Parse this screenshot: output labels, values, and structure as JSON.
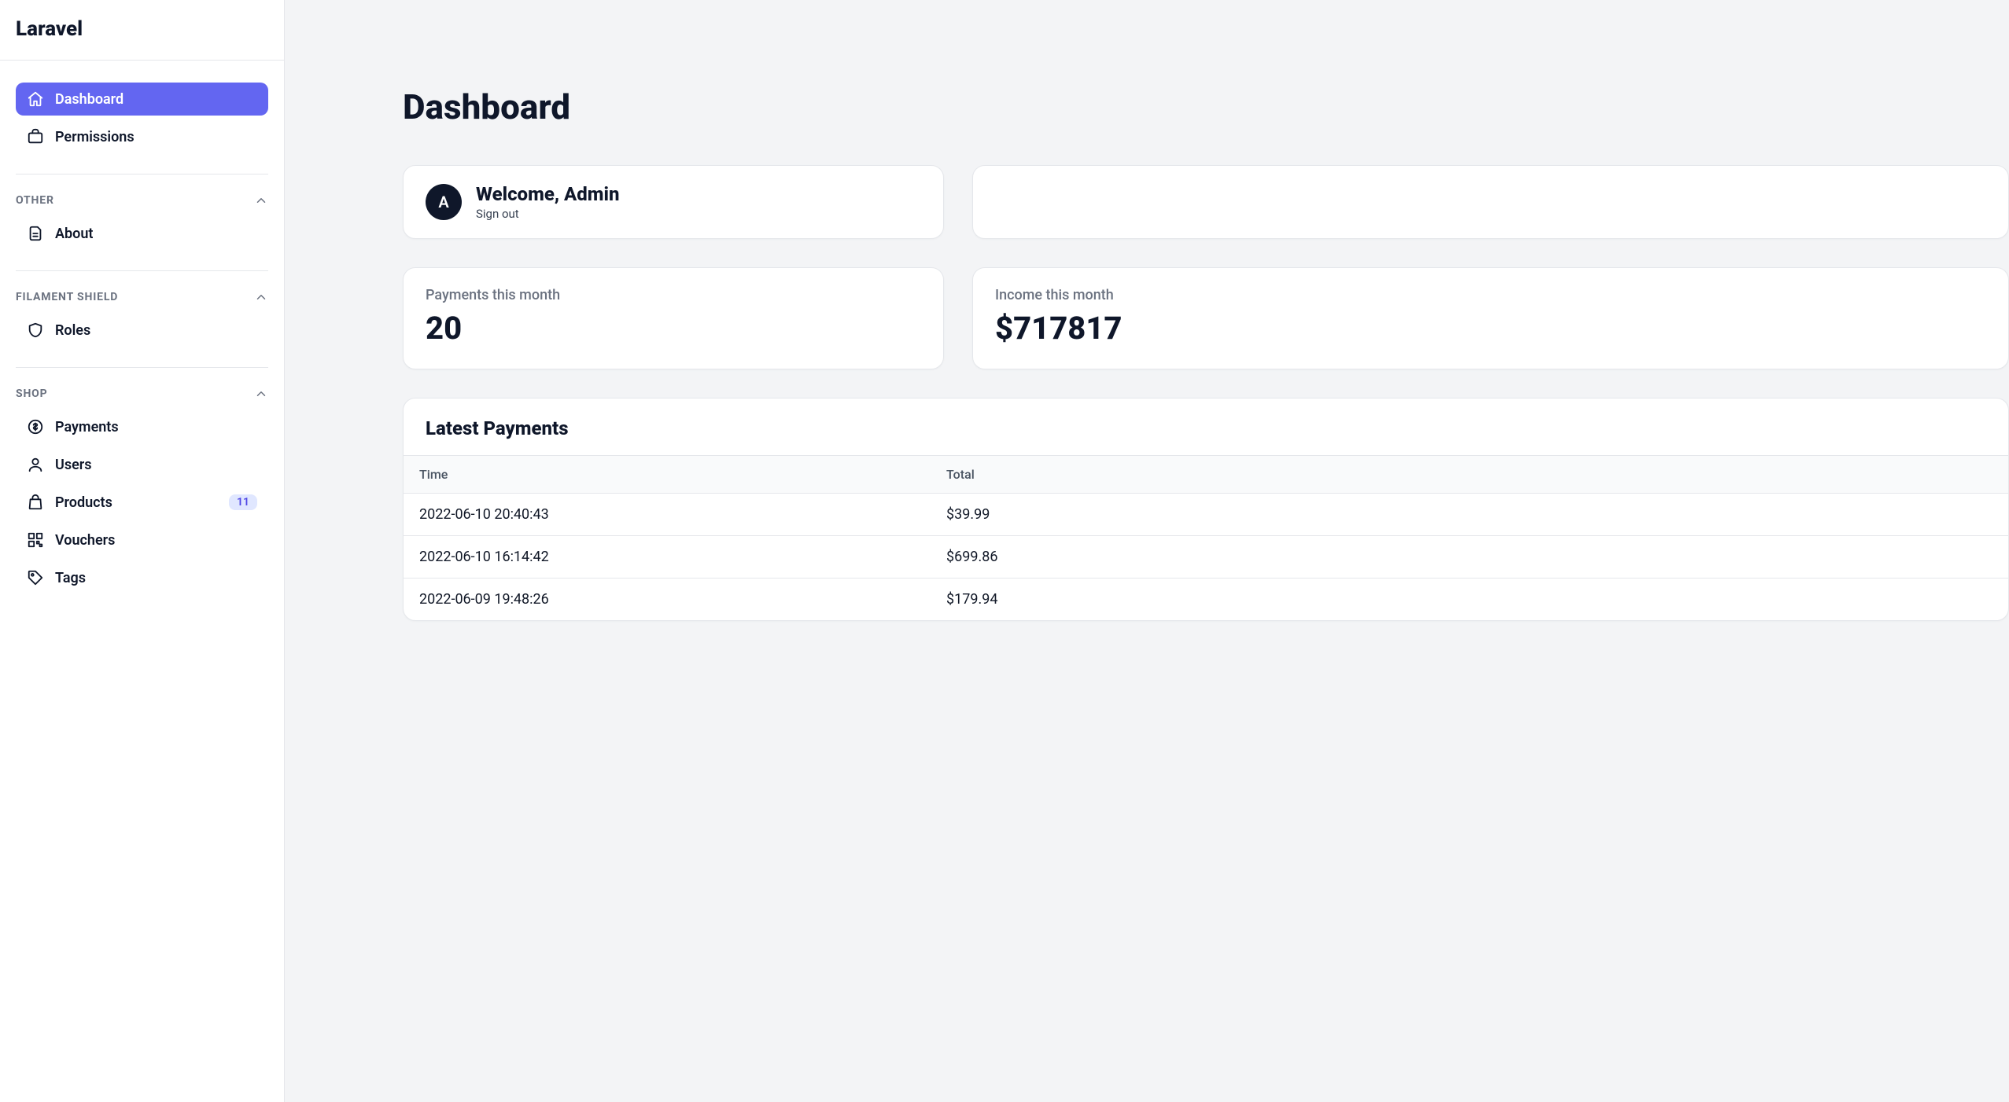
{
  "brand": "Laravel",
  "sidebar": {
    "top": [
      {
        "label": "Dashboard",
        "icon": "home",
        "active": true
      },
      {
        "label": "Permissions",
        "icon": "briefcase",
        "active": false
      }
    ],
    "groups": [
      {
        "title": "OTHER",
        "items": [
          {
            "label": "About",
            "icon": "document"
          }
        ]
      },
      {
        "title": "FILAMENT SHIELD",
        "items": [
          {
            "label": "Roles",
            "icon": "shield"
          }
        ]
      },
      {
        "title": "SHOP",
        "items": [
          {
            "label": "Payments",
            "icon": "currency"
          },
          {
            "label": "Users",
            "icon": "user"
          },
          {
            "label": "Products",
            "icon": "bag",
            "badge": "11"
          },
          {
            "label": "Vouchers",
            "icon": "qrcode"
          },
          {
            "label": "Tags",
            "icon": "tag"
          }
        ]
      }
    ]
  },
  "page": {
    "title": "Dashboard",
    "welcome": {
      "avatar_initial": "A",
      "greeting": "Welcome, Admin",
      "signout_label": "Sign out"
    },
    "stats": [
      {
        "label": "Payments this month",
        "value": "20"
      },
      {
        "label": "Income this month",
        "value": "$717817"
      }
    ],
    "latest_payments": {
      "title": "Latest Payments",
      "columns": [
        "Time",
        "Total"
      ],
      "rows": [
        {
          "time": "2022-06-10 20:40:43",
          "total": "$39.99"
        },
        {
          "time": "2022-06-10 16:14:42",
          "total": "$699.86"
        },
        {
          "time": "2022-06-09 19:48:26",
          "total": "$179.94"
        }
      ]
    }
  }
}
